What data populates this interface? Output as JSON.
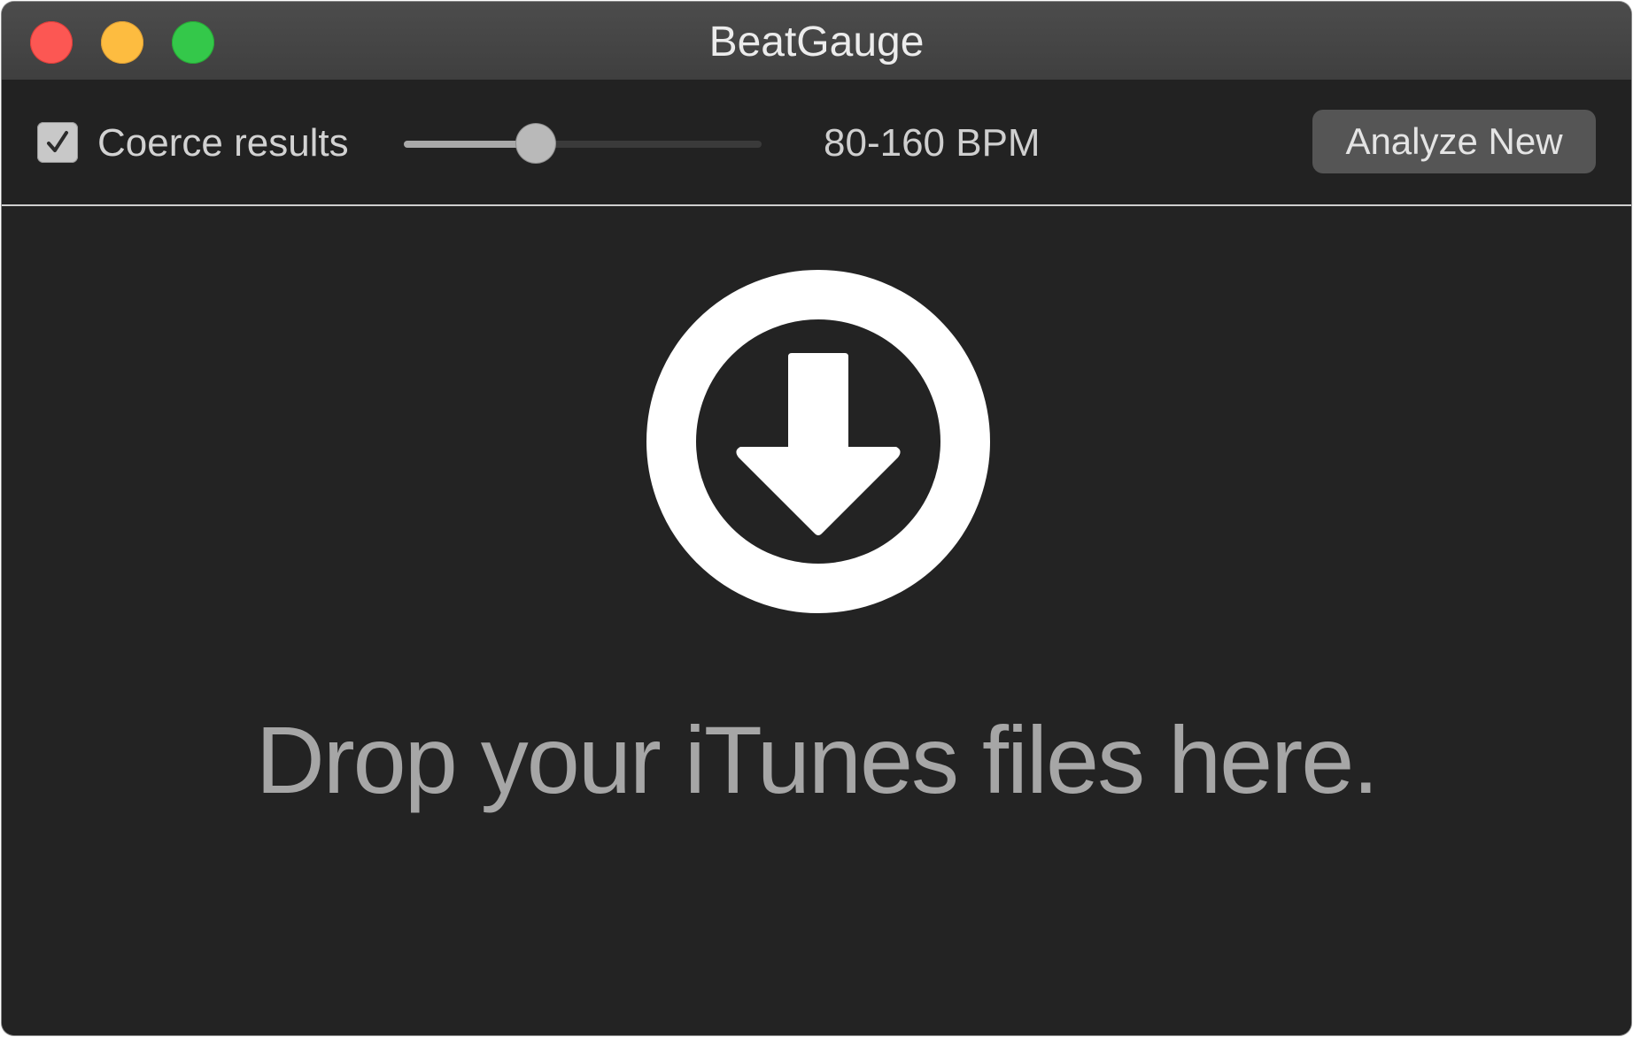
{
  "window": {
    "title": "BeatGauge"
  },
  "traffic_lights": {
    "close_color": "#fc5753",
    "minimize_color": "#fdbc40",
    "maximize_color": "#34c84a"
  },
  "toolbar": {
    "coerce_checkbox": {
      "label": "Coerce results",
      "checked": true
    },
    "tempo_slider": {
      "value_fraction": 0.37
    },
    "bpm_range_label": "80-160 BPM",
    "analyze_button_label": "Analyze New"
  },
  "dropzone": {
    "icon": "download-circle-icon",
    "message": "Drop your iTunes files here."
  }
}
